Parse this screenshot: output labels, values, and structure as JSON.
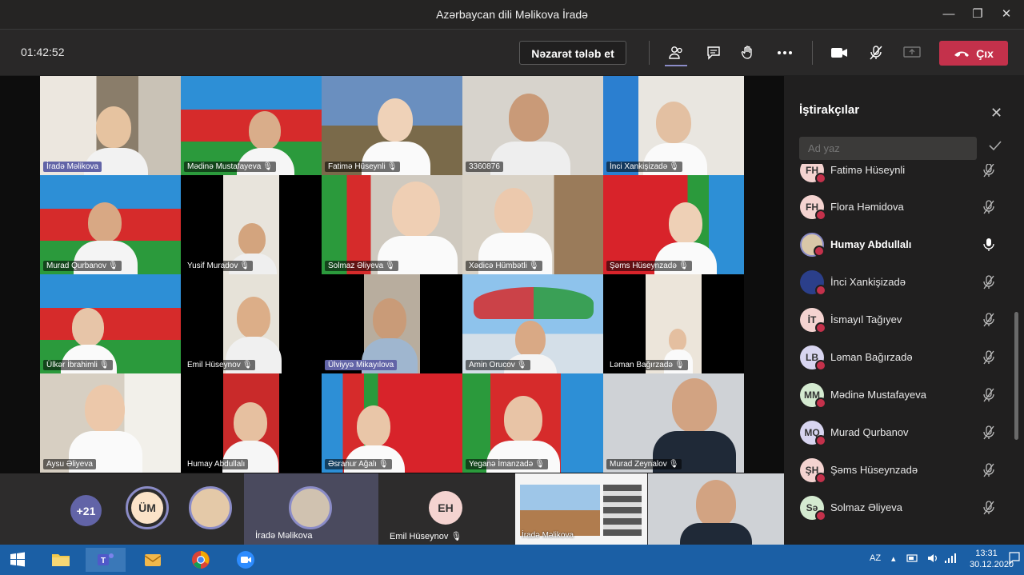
{
  "window": {
    "title": "Azərbaycan dili Məlikova İradə",
    "minimize": "—",
    "maximize": "❐",
    "close": "✕"
  },
  "toolbar": {
    "timer": "01:42:52",
    "control_label": "Nəzarət tələb et",
    "leave_label": "Çıx"
  },
  "tiles": [
    {
      "name": "İradə Məlikova",
      "highlight": true
    },
    {
      "name": "Mədinə Mustafayeva",
      "mic": true
    },
    {
      "name": "Fatimə Hüseynli",
      "mic": true
    },
    {
      "name": "3360876"
    },
    {
      "name": "İnci Xankişizadə",
      "mic": true
    },
    {
      "name": "Murad Qurbanov",
      "mic": true
    },
    {
      "name": "Yusif Muradov",
      "mic": true
    },
    {
      "name": "Solmaz Əliyeva",
      "mic": true
    },
    {
      "name": "Xədicə Hümbətli",
      "mic": true
    },
    {
      "name": "Şəms Hüseynzadə",
      "mic": true
    },
    {
      "name": "Ülkər İbrahimli",
      "mic": true
    },
    {
      "name": "Emil Hüseynov",
      "mic": true
    },
    {
      "name": "Ülviyyə Mikayılova",
      "highlight": true
    },
    {
      "name": "Amin Orucov",
      "mic": true
    },
    {
      "name": "Ləman Bağırzadə",
      "mic": true
    },
    {
      "name": "Aysu Əliyeva"
    },
    {
      "name": "Humay Abdullalı"
    },
    {
      "name": "Əsranur Ağalı",
      "mic": true
    },
    {
      "name": "Yeganə İmanzadə",
      "mic": true
    },
    {
      "name": "Murad Zeynalov",
      "mic": true
    }
  ],
  "bottom_row": {
    "overflow": "+21",
    "um_initials": "ÜM",
    "irade_label": "İradə Məlikova",
    "emil_initials": "EH",
    "emil_label": "Emil Hüseynov",
    "share_label": "İradə Məlikova"
  },
  "participants_panel": {
    "title": "İştirakçılar",
    "search_placeholder": "Ad yaz",
    "items": [
      {
        "initials": "FH",
        "name": "Fatimə Hüseynli",
        "color": "#f4d3d0",
        "mic": "muted"
      },
      {
        "initials": "FH",
        "name": "Flora Həmidova",
        "color": "#f4d3d0",
        "mic": "muted"
      },
      {
        "initials": "",
        "name": "Humay Abdullalı",
        "color": "#d9c7a8",
        "mic": "on",
        "bold": true
      },
      {
        "initials": "",
        "name": "İnci Xankişizadə",
        "color": "#2b3f8a",
        "mic": "muted"
      },
      {
        "initials": "İT",
        "name": "İsmayıl Tağıyev",
        "color": "#f4d3d0",
        "mic": "muted"
      },
      {
        "initials": "LB",
        "name": "Ləman Bağırzadə",
        "color": "#d8d5f0",
        "mic": "muted"
      },
      {
        "initials": "MM",
        "name": "Mədinə Mustafayeva",
        "color": "#d4ead0",
        "mic": "muted"
      },
      {
        "initials": "MQ",
        "name": "Murad Qurbanov",
        "color": "#d8d5f0",
        "mic": "muted"
      },
      {
        "initials": "ŞH",
        "name": "Şəms Hüseynzadə",
        "color": "#f4d3d0",
        "mic": "muted"
      },
      {
        "initials": "Sə",
        "name": "Solmaz Əliyeva",
        "color": "#d4ead0",
        "mic": "muted"
      }
    ]
  },
  "taskbar": {
    "lang": "AZ",
    "time": "13:31",
    "date": "30.12.2020"
  },
  "colors": {
    "accent": "#6264a7",
    "leave": "#c4314b",
    "taskbar": "#1b5fa5"
  }
}
